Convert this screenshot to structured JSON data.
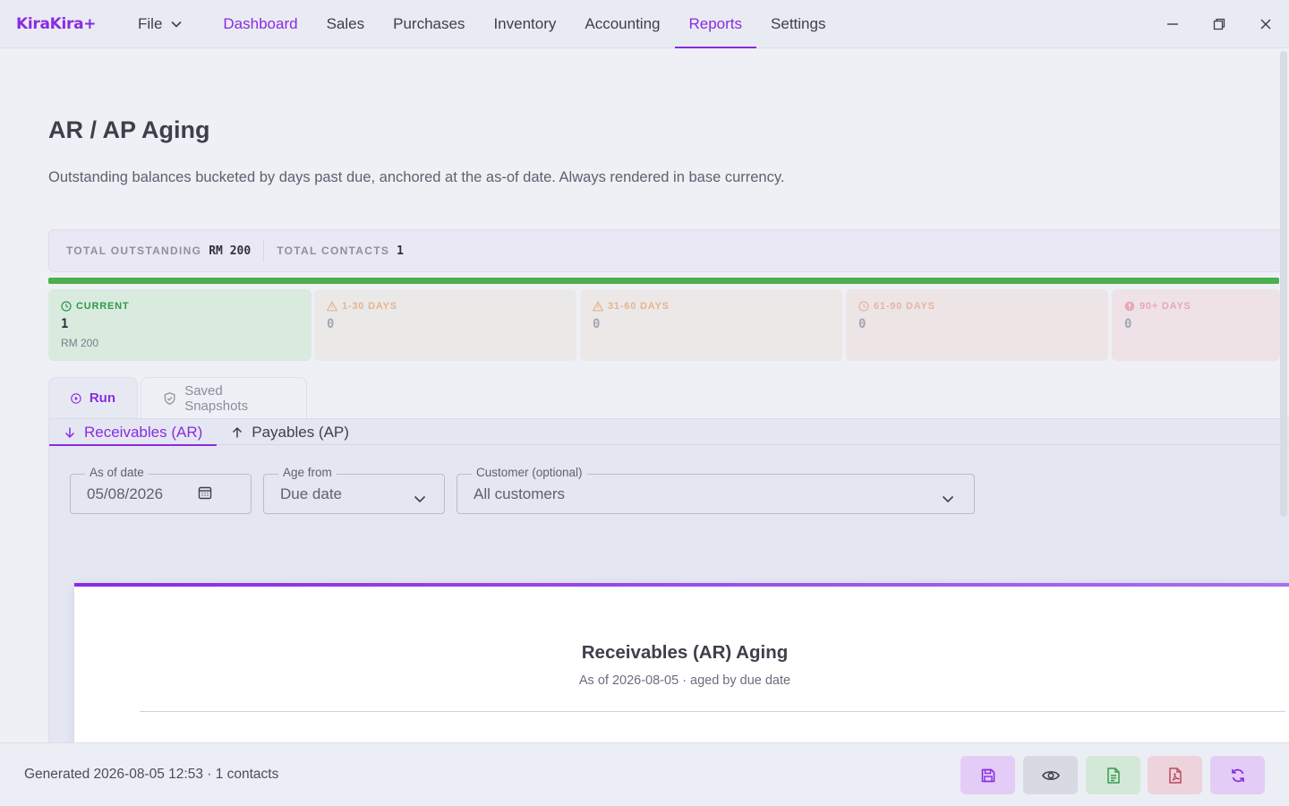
{
  "app": {
    "name": "KiraKira+"
  },
  "menu": {
    "file": "File",
    "items": [
      "Dashboard",
      "Sales",
      "Purchases",
      "Inventory",
      "Accounting",
      "Reports",
      "Settings"
    ]
  },
  "page": {
    "title": "AR / AP Aging",
    "description": "Outstanding balances bucketed by days past due, anchored at the as-of date. Always rendered in base currency."
  },
  "summary": {
    "total_outstanding_label": "TOTAL OUTSTANDING",
    "total_outstanding_value": "RM 200",
    "total_contacts_label": "TOTAL CONTACTS",
    "total_contacts_value": "1",
    "current_share": 1.0
  },
  "buckets": [
    {
      "label": "CURRENT",
      "count": "1",
      "amount": "RM 200"
    },
    {
      "label": "1-30 DAYS",
      "count": "0"
    },
    {
      "label": "31-60 DAYS",
      "count": "0"
    },
    {
      "label": "61-90 DAYS",
      "count": "0"
    },
    {
      "label": "90+ DAYS",
      "count": "0"
    }
  ],
  "tabs": {
    "run": "Run",
    "saved": "Saved Snapshots"
  },
  "subtabs": {
    "ar": "Receivables (AR)",
    "ap": "Payables (AP)"
  },
  "filters": {
    "as_of_label": "As of date",
    "as_of_value": "05/08/2026",
    "age_from_label": "Age from",
    "age_from_value": "Due date",
    "customer_label": "Customer (optional)",
    "customer_value": "All customers"
  },
  "report": {
    "title": "Receivables (AR) Aging",
    "subtitle": "As of 2026-08-05 · aged by due date"
  },
  "footer": {
    "status": "Generated 2026-08-05 12:53 · 1 contacts"
  },
  "colors": {
    "accent": "#8a2be2",
    "current": "#4caf50",
    "days_1_30": "#e0a36c",
    "days_31_60": "#e0a36c",
    "days_61_90": "#e59a8c",
    "days_90_plus": "#e68aa0"
  }
}
